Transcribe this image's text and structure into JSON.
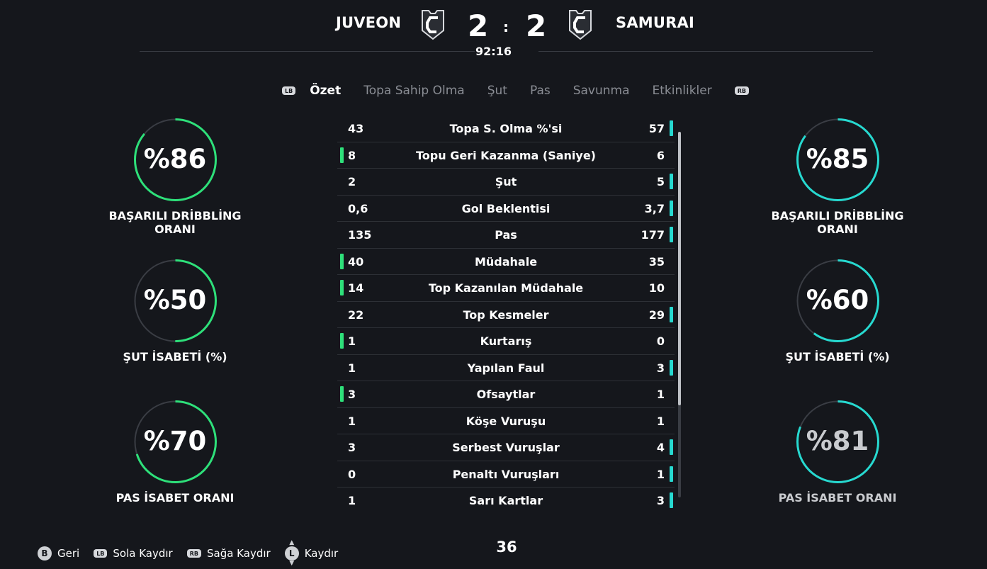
{
  "header": {
    "home_team": "JUVEON",
    "away_team": "SAMURAI",
    "home_score": "2",
    "away_score": "2",
    "separator": ":",
    "clock": "92:16"
  },
  "tabs": {
    "lb": "LB",
    "rb": "RB",
    "items": [
      "Özet",
      "Topa Sahip Olma",
      "Şut",
      "Pas",
      "Savunma",
      "Etkinlikler"
    ],
    "active_index": 0
  },
  "left_stats": [
    {
      "value": "%86",
      "label": "BAŞARILI DRİBBLİNG ORANI",
      "fraction": 0.86
    },
    {
      "value": "%50",
      "label": "ŞUT İSABETİ (%)",
      "fraction": 0.5
    },
    {
      "value": "%70",
      "label": "PAS İSABET ORANI",
      "fraction": 0.7
    }
  ],
  "right_stats": [
    {
      "value": "%85",
      "label": "BAŞARILI DRİBBLİNG ORANI",
      "fraction": 0.85
    },
    {
      "value": "%60",
      "label": "ŞUT İSABETİ (%)",
      "fraction": 0.6
    },
    {
      "value": "%81",
      "label": "PAS İSABET ORANI",
      "fraction": 0.81
    }
  ],
  "table": [
    {
      "left": "43",
      "name": "Topa S. Olma %'si",
      "right": "57",
      "leader": "right"
    },
    {
      "left": "8",
      "name": "Topu Geri Kazanma (Saniye)",
      "right": "6",
      "leader": "left"
    },
    {
      "left": "2",
      "name": "Şut",
      "right": "5",
      "leader": "right"
    },
    {
      "left": "0,6",
      "name": "Gol Beklentisi",
      "right": "3,7",
      "leader": "right"
    },
    {
      "left": "135",
      "name": "Pas",
      "right": "177",
      "leader": "right"
    },
    {
      "left": "40",
      "name": "Müdahale",
      "right": "35",
      "leader": "left"
    },
    {
      "left": "14",
      "name": "Top Kazanılan Müdahale",
      "right": "10",
      "leader": "left"
    },
    {
      "left": "22",
      "name": "Top Kesmeler",
      "right": "29",
      "leader": "right"
    },
    {
      "left": "1",
      "name": "Kurtarış",
      "right": "0",
      "leader": "left"
    },
    {
      "left": "1",
      "name": "Yapılan Faul",
      "right": "3",
      "leader": "right"
    },
    {
      "left": "3",
      "name": "Ofsaytlar",
      "right": "1",
      "leader": "left"
    },
    {
      "left": "1",
      "name": "Köşe Vuruşu",
      "right": "1",
      "leader": "none"
    },
    {
      "left": "3",
      "name": "Serbest Vuruşlar",
      "right": "4",
      "leader": "right"
    },
    {
      "left": "0",
      "name": "Penaltı Vuruşları",
      "right": "1",
      "leader": "right"
    },
    {
      "left": "1",
      "name": "Sarı Kartlar",
      "right": "3",
      "leader": "right"
    }
  ],
  "footer": {
    "back_key": "B",
    "back": "Geri",
    "lb_key": "LB",
    "lb": "Sola Kaydır",
    "rb_key": "RB",
    "rb": "Sağa Kaydır",
    "stick_key": "L",
    "stick": "Kaydır",
    "page": "36"
  },
  "colors": {
    "home": "#2ee07a",
    "away": "#27d9d0",
    "ring_track": "#3a3d44",
    "background": "#15171c"
  },
  "icons": {
    "home_crest": "team-crest-icon",
    "away_crest": "team-crest-icon",
    "stick": "left-stick-icon"
  }
}
